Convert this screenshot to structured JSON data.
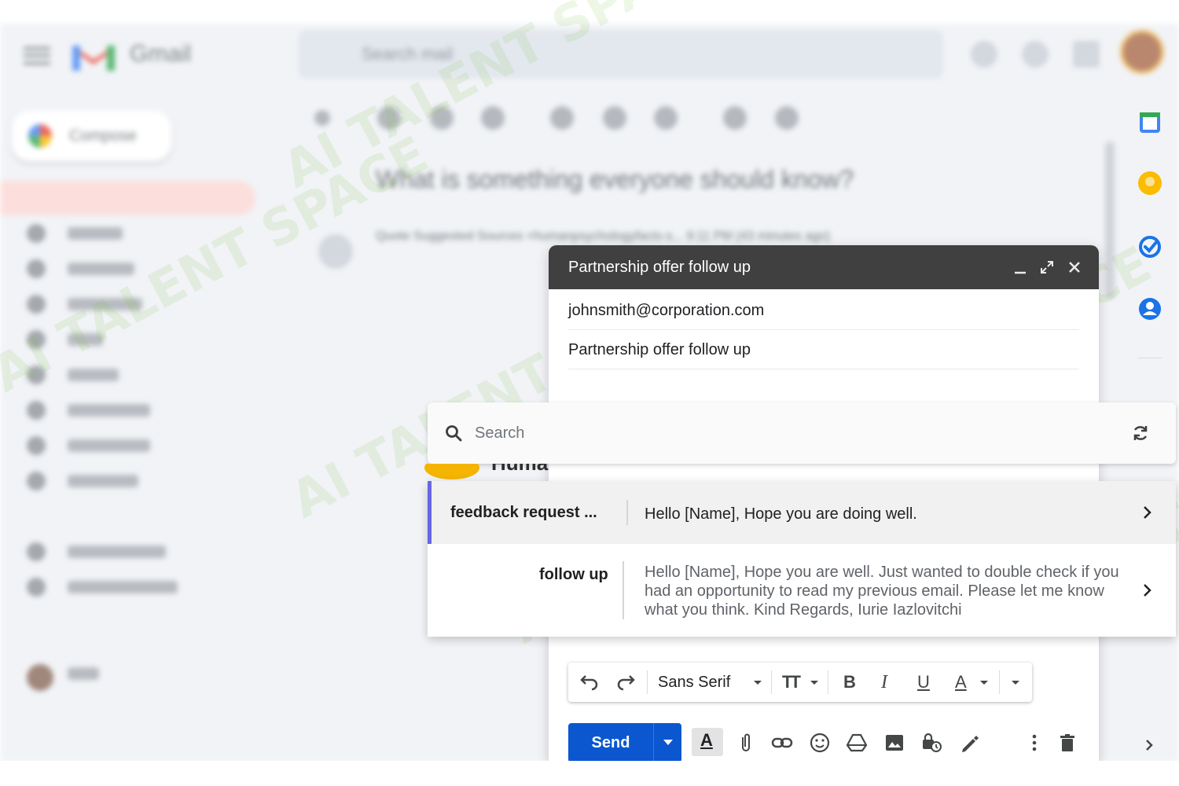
{
  "background": {
    "app_name": "Gmail",
    "search_placeholder": "Search mail",
    "compose_label": "Compose",
    "subject": "What is something everyone should know?",
    "from_line": "Quote Suggested Sources <humanpsychologyfacts-s...   9:11 PM (43 minutes ago)",
    "watermark": "AI TALENT SPACE"
  },
  "compose": {
    "title": "Partnership offer follow up",
    "to": "johnsmith@corporation.com",
    "subject": "Partnership offer follow up",
    "peek_text": "Huma"
  },
  "template_picker": {
    "search_placeholder": "Search",
    "templates": [
      {
        "name": "feedback request ...",
        "body": "Hello [Name], Hope you are doing well."
      },
      {
        "name": "follow up",
        "body": "Hello [Name], Hope you are well. Just wanted to double check if you had an opportunity to read my previous email. Please let me know what you think. Kind Regards, Iurie Iazlovitchi"
      }
    ]
  },
  "formatting": {
    "font": "Sans Serif",
    "bold": "B",
    "italic": "I",
    "underline": "U",
    "text_color": "A",
    "text_size": "TT"
  },
  "footer": {
    "send_label": "Send",
    "format_icon_glyph": "A"
  },
  "colors": {
    "accent": "#0b57d0",
    "selected_bar": "#6865e6",
    "compose_header": "#404040"
  }
}
